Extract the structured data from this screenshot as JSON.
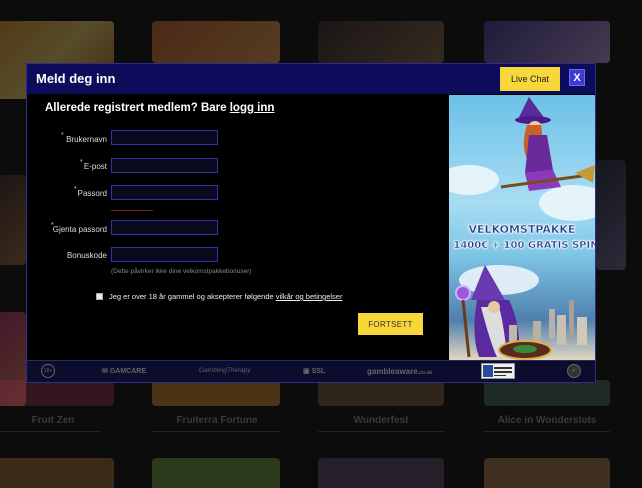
{
  "background": {
    "games_row2": [
      "Fruit Zen",
      "Fruiterra Fortune",
      "Wunderfest",
      "Alice in Wonderslots"
    ]
  },
  "modal": {
    "title": "Meld deg inn",
    "live_chat_label": "Live Chat",
    "close_label": "X",
    "subtitle_prefix": "Allerede registrert medlem? Bare ",
    "subtitle_link": "logg inn",
    "fields": {
      "username": {
        "label": "Brukernavn",
        "value": ""
      },
      "email": {
        "label": "E-post",
        "value": ""
      },
      "password": {
        "label": "Passord",
        "value": ""
      },
      "repeat_password": {
        "label": "Gjenta passord",
        "value": ""
      },
      "bonus_code": {
        "label": "Bonuskode",
        "value": ""
      }
    },
    "required_marker": "*",
    "bonus_note": "(Dette påvirker ikke dine velkomstpakkebonuser)",
    "terms_prefix": "Jeg er over 18 år gammel og aksepterer følgende ",
    "terms_link": "vilkår og betingelser",
    "submit_label": "FORTSETT",
    "promo": {
      "line1": "VELKOMSTPAKKE",
      "line2": "1400€ + 100 GRATIS SPIN"
    },
    "footer": {
      "age_badge": "18+",
      "gamcare": "GAMCARE",
      "gamblingtherapy": "GamblingTherapy",
      "ssl": "SSL",
      "gambleaware": "gambleaware",
      "gambleaware_suffix": ".co.uk"
    }
  },
  "colors": {
    "header_bg": "#0c0c5a",
    "accent_yellow": "#f7d73a",
    "close_blue": "#3b3bd6",
    "input_border": "#3232a8"
  }
}
